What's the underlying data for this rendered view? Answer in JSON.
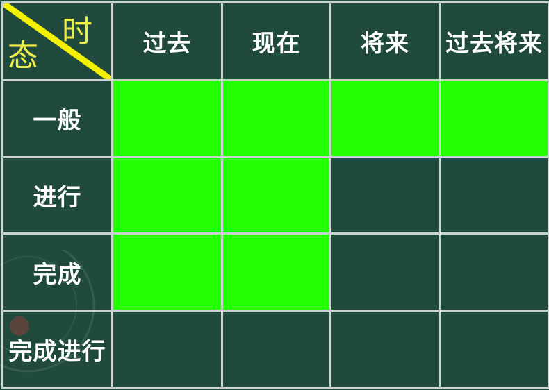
{
  "corner": {
    "top_right": "时",
    "bottom_left": "态",
    "line_color": "#f3f000"
  },
  "columns": [
    "过去",
    "现在",
    "将来",
    "过去将来"
  ],
  "rows": [
    {
      "label": "一般",
      "filled": [
        true,
        true,
        true,
        true
      ]
    },
    {
      "label": "进行",
      "filled": [
        true,
        true,
        false,
        false
      ]
    },
    {
      "label": "完成",
      "filled": [
        true,
        true,
        false,
        false
      ]
    },
    {
      "label": "完成进行",
      "filled": [
        false,
        false,
        false,
        false
      ]
    }
  ],
  "colors": {
    "board": "#1f4a3d",
    "grid_line": "#c9d3cf",
    "highlight": "#22ff00",
    "header_text": "#ffffff",
    "corner_text": "#f0ef4a"
  }
}
